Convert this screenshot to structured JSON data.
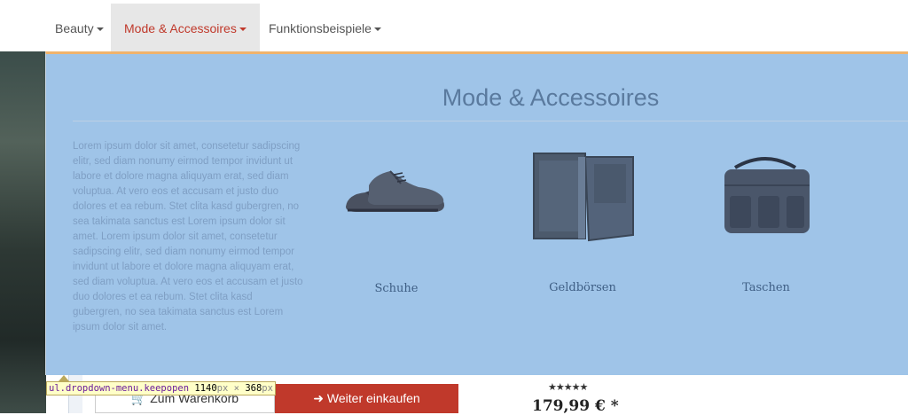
{
  "nav": {
    "items": [
      {
        "label": "Beauty"
      },
      {
        "label": "Mode & Accessoires"
      },
      {
        "label": "Funktionsbeispiele"
      }
    ],
    "active_color": "#c0392b"
  },
  "dropdown": {
    "title": "Mode & Accessoires",
    "description": "Lorem ipsum dolor sit amet, consetetur sadipscing elitr, sed diam nonumy eirmod tempor invidunt ut labore et dolore magna aliquyam erat, sed diam voluptua. At vero eos et accusam et justo duo dolores et ea rebum. Stet clita kasd gubergren, no sea takimata sanctus est Lorem ipsum dolor sit amet. Lorem ipsum dolor sit amet, consetetur sadipscing elitr, sed diam nonumy eirmod tempor invidunt ut labore et dolore magna aliquyam erat, sed diam voluptua. At vero eos et accusam et justo duo dolores et ea rebum. Stet clita kasd gubergren, no sea takimata sanctus est Lorem ipsum dolor sit amet.",
    "categories": [
      {
        "label": "Schuhe",
        "icon": "shoe-icon"
      },
      {
        "label": "Geldbörsen",
        "icon": "wallet-icon"
      },
      {
        "label": "Taschen",
        "icon": "bag-icon"
      }
    ],
    "background": "#9fc4e8",
    "accent_border": "#f0b36c"
  },
  "devtools_tooltip": {
    "selector": "ul.dropdown-menu.keepopen",
    "width": "1140",
    "times": "×",
    "height": "368",
    "unit": "px"
  },
  "buttons": {
    "cart": "Zum Warenkorb",
    "continue": "Weiter einkaufen"
  },
  "product": {
    "stars": "★★★★★",
    "rating": 5,
    "price": "179,99 € *"
  }
}
